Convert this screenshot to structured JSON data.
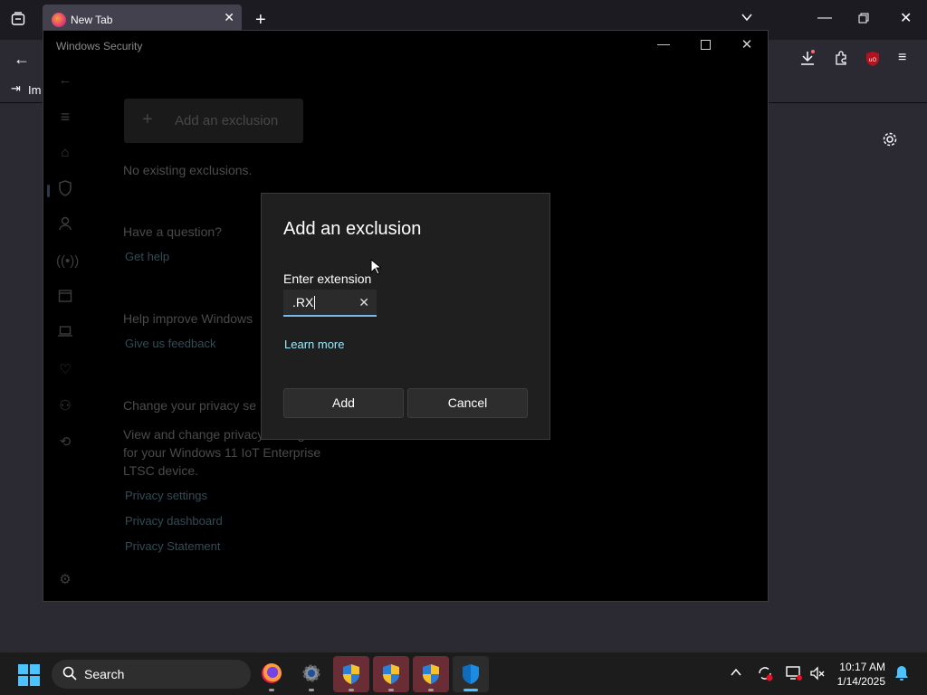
{
  "browser": {
    "tab_title": "New Tab",
    "bookmark_label": "Im"
  },
  "window": {
    "title": "Windows Security"
  },
  "page": {
    "add_exclusion_label": "Add an exclusion",
    "no_exclusions": "No existing exclusions.",
    "question_heading": "Have a question?",
    "get_help": "Get help",
    "improve_heading": "Help improve Windows",
    "feedback": "Give us feedback",
    "privacy_heading": "Change your privacy se",
    "privacy_text_1": "View and change privacy settings",
    "privacy_text_2": "for your Windows 11 IoT Enterprise",
    "privacy_text_3": "LTSC device.",
    "privacy_settings": "Privacy settings",
    "privacy_dashboard": "Privacy dashboard",
    "privacy_statement": "Privacy Statement"
  },
  "dialog": {
    "title": "Add an exclusion",
    "field_label": "Enter extension",
    "field_value": ".RX",
    "learn_more": "Learn more",
    "add_button": "Add",
    "cancel_button": "Cancel"
  },
  "taskbar": {
    "search_label": "Search",
    "time": "10:17 AM",
    "date": "1/14/2025"
  },
  "colors": {
    "accent": "#4cc2ff",
    "link": "#99ebff",
    "input_focus": "#76b9ed"
  }
}
